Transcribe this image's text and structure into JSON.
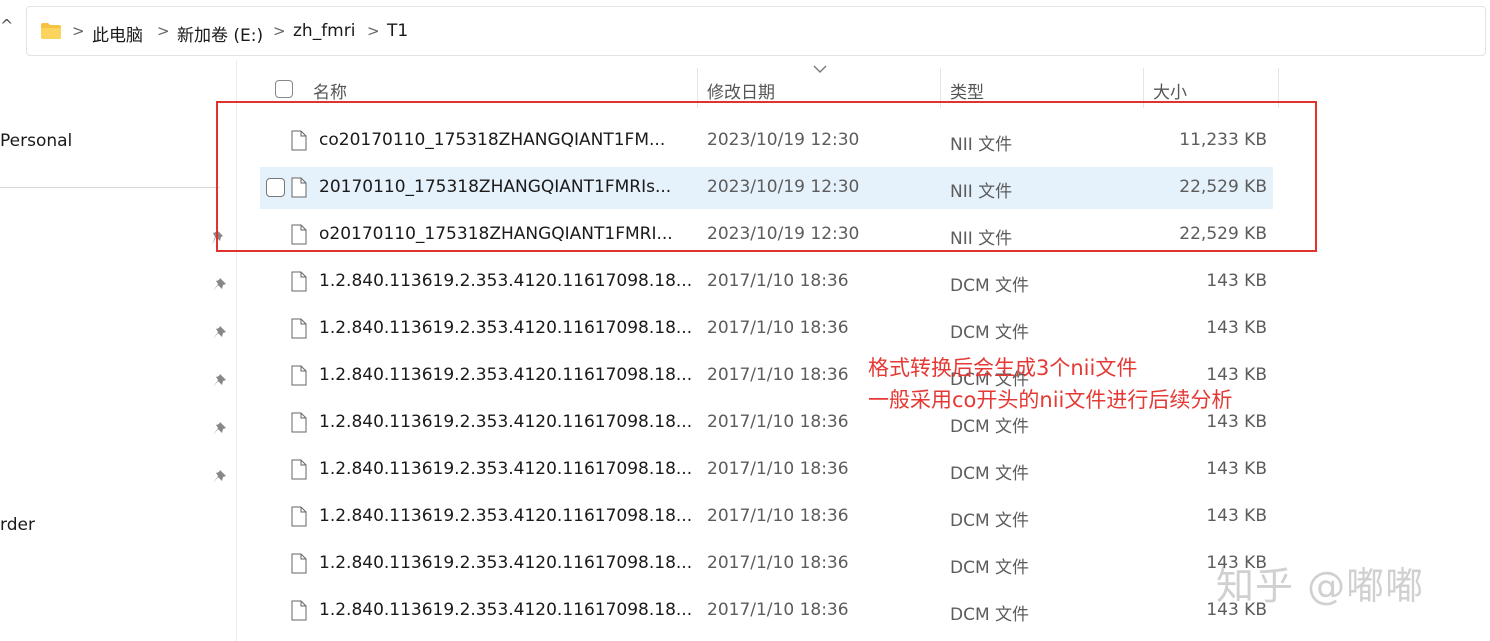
{
  "breadcrumb": {
    "items": [
      "此电脑",
      "新加卷 (E:)",
      "zh_fmri",
      "T1"
    ]
  },
  "sidebar": {
    "items": [
      {
        "label": "Personal"
      },
      {
        "label": "rder"
      }
    ]
  },
  "columns": {
    "name": "名称",
    "date": "修改日期",
    "type": "类型",
    "size": "大小"
  },
  "files": [
    {
      "name": "co20170110_175318ZHANGQIANT1FM...",
      "date": "2023/10/19 12:30",
      "type": "NII 文件",
      "size": "11,233 KB"
    },
    {
      "name": "20170110_175318ZHANGQIANT1FMRIs...",
      "date": "2023/10/19 12:30",
      "type": "NII 文件",
      "size": "22,529 KB"
    },
    {
      "name": "o20170110_175318ZHANGQIANT1FMRI...",
      "date": "2023/10/19 12:30",
      "type": "NII 文件",
      "size": "22,529 KB"
    },
    {
      "name": "1.2.840.113619.2.353.4120.11617098.18...",
      "date": "2017/1/10 18:36",
      "type": "DCM 文件",
      "size": "143 KB"
    },
    {
      "name": "1.2.840.113619.2.353.4120.11617098.18...",
      "date": "2017/1/10 18:36",
      "type": "DCM 文件",
      "size": "143 KB"
    },
    {
      "name": "1.2.840.113619.2.353.4120.11617098.18...",
      "date": "2017/1/10 18:36",
      "type": "DCM 文件",
      "size": "143 KB"
    },
    {
      "name": "1.2.840.113619.2.353.4120.11617098.18...",
      "date": "2017/1/10 18:36",
      "type": "DCM 文件",
      "size": "143 KB"
    },
    {
      "name": "1.2.840.113619.2.353.4120.11617098.18...",
      "date": "2017/1/10 18:36",
      "type": "DCM 文件",
      "size": "143 KB"
    },
    {
      "name": "1.2.840.113619.2.353.4120.11617098.18...",
      "date": "2017/1/10 18:36",
      "type": "DCM 文件",
      "size": "143 KB"
    },
    {
      "name": "1.2.840.113619.2.353.4120.11617098.18...",
      "date": "2017/1/10 18:36",
      "type": "DCM 文件",
      "size": "143 KB"
    },
    {
      "name": "1.2.840.113619.2.353.4120.11617098.18...",
      "date": "2017/1/10 18:36",
      "type": "DCM 文件",
      "size": "143 KB"
    }
  ],
  "annotation": {
    "line1": "格式转换后会生成3个nii文件",
    "line2": "一般采用co开头的nii文件进行后续分析",
    "color": "#e53935"
  },
  "watermark": "知乎 @嘟嘟",
  "colors": {
    "accent_highlight": "#e5f1fb",
    "annotation_red": "#e0332e",
    "folder_yellow": "#f5c242"
  },
  "icons": {
    "folder": "folder-icon",
    "file": "file-icon",
    "pin": "pin-icon",
    "chevron": "chevron-right-icon"
  }
}
